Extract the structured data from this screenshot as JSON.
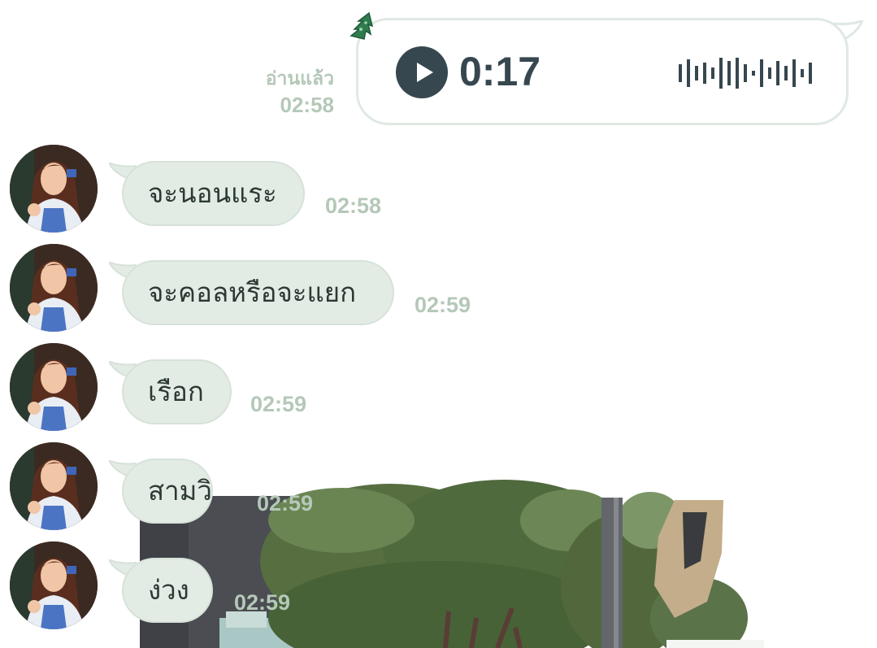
{
  "sent_voice": {
    "read_label": "อ่านแล้ว",
    "time": "02:58",
    "duration": "0:17",
    "play_icon": "play-icon",
    "waveform_icon": "waveform-icon",
    "decoration_icon": "christmas-tree-icon"
  },
  "messages": [
    {
      "text": "จะนอนแระ",
      "time": "02:58"
    },
    {
      "text": "จะคอลหรือจะแยก",
      "time": "02:59"
    },
    {
      "text": "เรือก",
      "time": "02:59"
    },
    {
      "text": "สามวิ",
      "time": "02:59"
    },
    {
      "text": "ง่วง",
      "time": "02:59"
    }
  ],
  "colors": {
    "bubble": "#e3ebe5",
    "meta_text": "#b5c8b8",
    "play_button": "#37474f"
  }
}
